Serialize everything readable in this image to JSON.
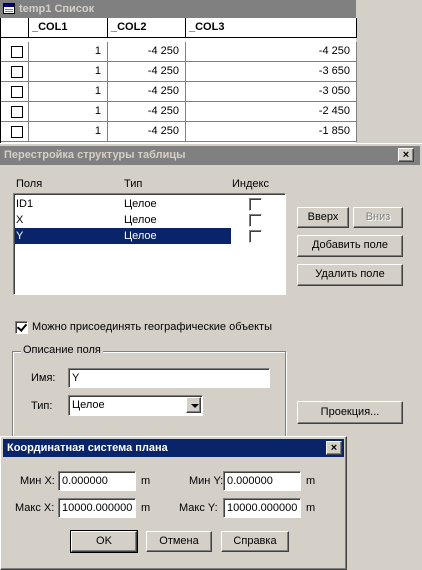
{
  "browser": {
    "title": "temp1 Список",
    "columns": [
      "_COL1",
      "_COL2",
      "_COL3"
    ],
    "rows": [
      {
        "col1": "1",
        "col2": "-4 250",
        "col3": "-4 250"
      },
      {
        "col1": "1",
        "col2": "-4 250",
        "col3": "-3 650"
      },
      {
        "col1": "1",
        "col2": "-4 250",
        "col3": "-3 050"
      },
      {
        "col1": "1",
        "col2": "-4 250",
        "col3": "-2 450"
      },
      {
        "col1": "1",
        "col2": "-4 250",
        "col3": "-1 850"
      }
    ]
  },
  "modify_dialog": {
    "title": "Перестройка структуры таблицы",
    "close_glyph": "×",
    "headers": {
      "fields": "Поля",
      "type": "Тип",
      "index": "Индекс"
    },
    "fields": [
      {
        "name": "ID1",
        "type": "Целое",
        "indexed": false,
        "selected": false
      },
      {
        "name": "X",
        "type": "Целое",
        "indexed": false,
        "selected": false
      },
      {
        "name": "Y",
        "type": "Целое",
        "indexed": false,
        "selected": true
      }
    ],
    "buttons": {
      "up": "Вверх",
      "down": "Вниз",
      "add_field": "Добавить поле",
      "delete_field": "Удалить поле",
      "projection": "Проекция..."
    },
    "attach_geo_label": "Можно присоединять географические объекты",
    "attach_geo_checked": true,
    "field_description": {
      "group_title": "Описание поля",
      "name_label": "Имя:",
      "name_value": "Y",
      "type_label": "Тип:",
      "type_value": "Целое"
    }
  },
  "coord_dialog": {
    "title": "Координатная система плана",
    "close_glyph": "×",
    "min_x_label": "Мин X:",
    "min_x_value": "0.000000",
    "min_x_unit": "m",
    "max_x_label": "Макс X:",
    "max_x_value": "10000.000000",
    "max_x_unit": "m",
    "min_y_label": "Мин Y:",
    "min_y_value": "0.000000",
    "min_y_unit": "m",
    "max_y_label": "Макс Y:",
    "max_y_value": "10000.000000",
    "max_y_unit": "m",
    "buttons": {
      "ok": "OK",
      "cancel": "Отмена",
      "help": "Справка"
    }
  }
}
